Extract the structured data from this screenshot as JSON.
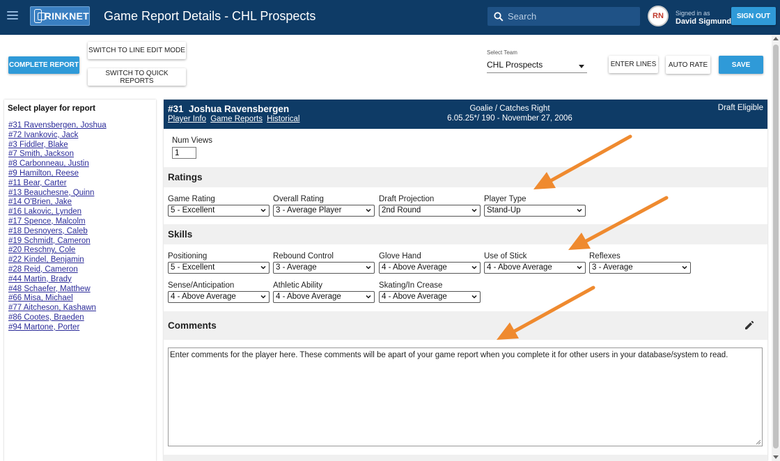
{
  "colors": {
    "nav": "#0e3b66",
    "accent": "#2f9ad8",
    "annotation": "#ef8a2f"
  },
  "nav": {
    "logo_text": "RINKNET",
    "title": "Game Report Details - CHL Prospects",
    "search_placeholder": "Search",
    "avatar_initials": "RN",
    "signed_in_label": "Signed in as",
    "user_name": "David Sigmund",
    "sign_out_label": "SIGN OUT"
  },
  "toolbar": {
    "complete_report_label": "COMPLETE REPORT",
    "line_edit_label": "SWITCH TO LINE EDIT MODE",
    "quick_reports_label": "SWITCH TO QUICK REPORTS",
    "select_team_label": "Select Team",
    "selected_team": "CHL Prospects",
    "enter_lines_label": "ENTER LINES",
    "auto_rate_label": "AUTO RATE",
    "save_label": "SAVE"
  },
  "sidebar": {
    "title": "Select player for report",
    "players": [
      "#31 Ravensbergen, Joshua",
      "#72 Ivankovic, Jack",
      "#3 Fiddler, Blake",
      "#7 Smith, Jackson",
      "#8 Carbonneau, Justin",
      "#9 Hamilton, Reese",
      "#11 Bear, Carter",
      "#13 Beauchesne, Quinn",
      "#14 O'Brien, Jake",
      "#16 Lakovic, Lynden",
      "#17 Spence, Malcolm",
      "#18 Desnoyers, Caleb",
      "#19 Schmidt, Cameron",
      "#20 Reschny, Cole",
      "#22 Kindel, Benjamin",
      "#28 Reid, Cameron",
      "#44 Martin, Brady",
      "#48 Schaefer, Matthew",
      "#66 Misa, Michael",
      "#77 Aitcheson, Kashawn",
      "#86 Cootes, Braeden",
      "#94 Martone, Porter"
    ]
  },
  "player": {
    "number": "#31",
    "name": "Joshua Ravensbergen",
    "links": [
      "Player Info",
      "Game Reports",
      "Historical"
    ],
    "position": "Goalie / Catches Right",
    "details": "6.05.25*/ 190 - November 27, 2006",
    "status": "Draft Eligible"
  },
  "num_views": {
    "label": "Num Views",
    "value": "1"
  },
  "ratings": {
    "title": "Ratings",
    "fields": [
      {
        "label": "Game Rating",
        "value": "5 - Excellent"
      },
      {
        "label": "Overall Rating",
        "value": "3 - Average Player"
      },
      {
        "label": "Draft Projection",
        "value": "2nd Round"
      },
      {
        "label": "Player Type",
        "value": "Stand-Up"
      }
    ]
  },
  "skills": {
    "title": "Skills",
    "fields": [
      {
        "label": "Positioning",
        "value": "5 - Excellent"
      },
      {
        "label": "Rebound Control",
        "value": "3 - Average"
      },
      {
        "label": "Glove Hand",
        "value": "4 - Above Average"
      },
      {
        "label": "Use of Stick",
        "value": "4 - Above Average"
      },
      {
        "label": "Reflexes",
        "value": "3 - Average"
      },
      {
        "label": "Sense/Anticipation",
        "value": "4 - Above Average"
      },
      {
        "label": "Athletic Ability",
        "value": "4 - Above Average"
      },
      {
        "label": "Skating/In Crease",
        "value": "4 - Above Average"
      }
    ]
  },
  "comments": {
    "title": "Comments",
    "text": "Enter comments for the player here.  These comments will be apart of your game report when you complete it for other users in your database/system to read."
  }
}
